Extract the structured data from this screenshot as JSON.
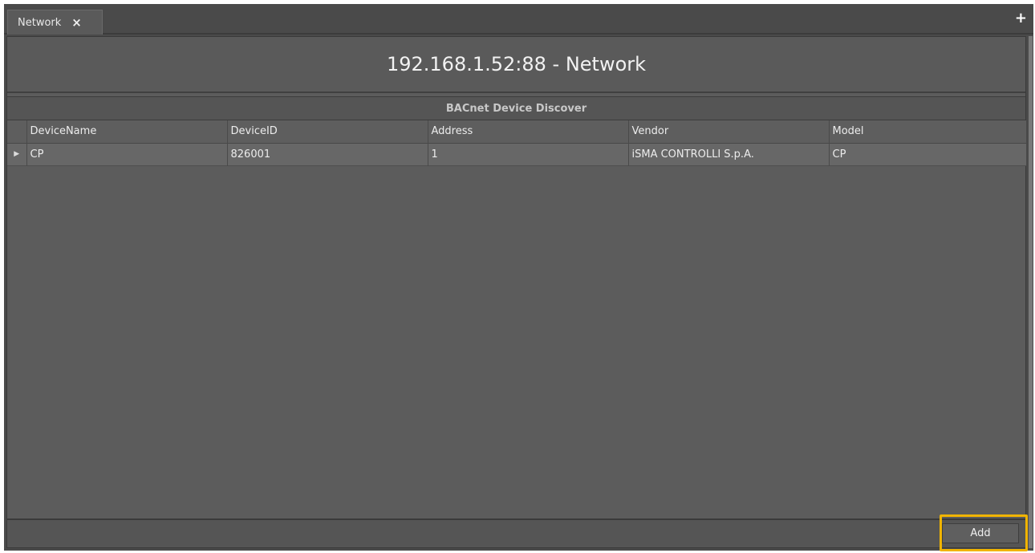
{
  "tabs": [
    {
      "label": "Network",
      "close_icon": "×",
      "active": true
    }
  ],
  "add_tab_icon": "+",
  "title": "192.168.1.52:88 - Network",
  "section_header": "BACnet Device Discover",
  "table": {
    "columns": [
      "DeviceName",
      "DeviceID",
      "Address",
      "Vendor",
      "Model"
    ],
    "rows": [
      {
        "indicator": "▶",
        "cells": [
          "CP",
          "826001",
          "1",
          "iSMA CONTROLLI S.p.A.",
          "CP"
        ]
      }
    ]
  },
  "footer": {
    "add_label": "Add"
  },
  "colors": {
    "highlight": "#f0b400",
    "background": "#5c5c5c"
  }
}
